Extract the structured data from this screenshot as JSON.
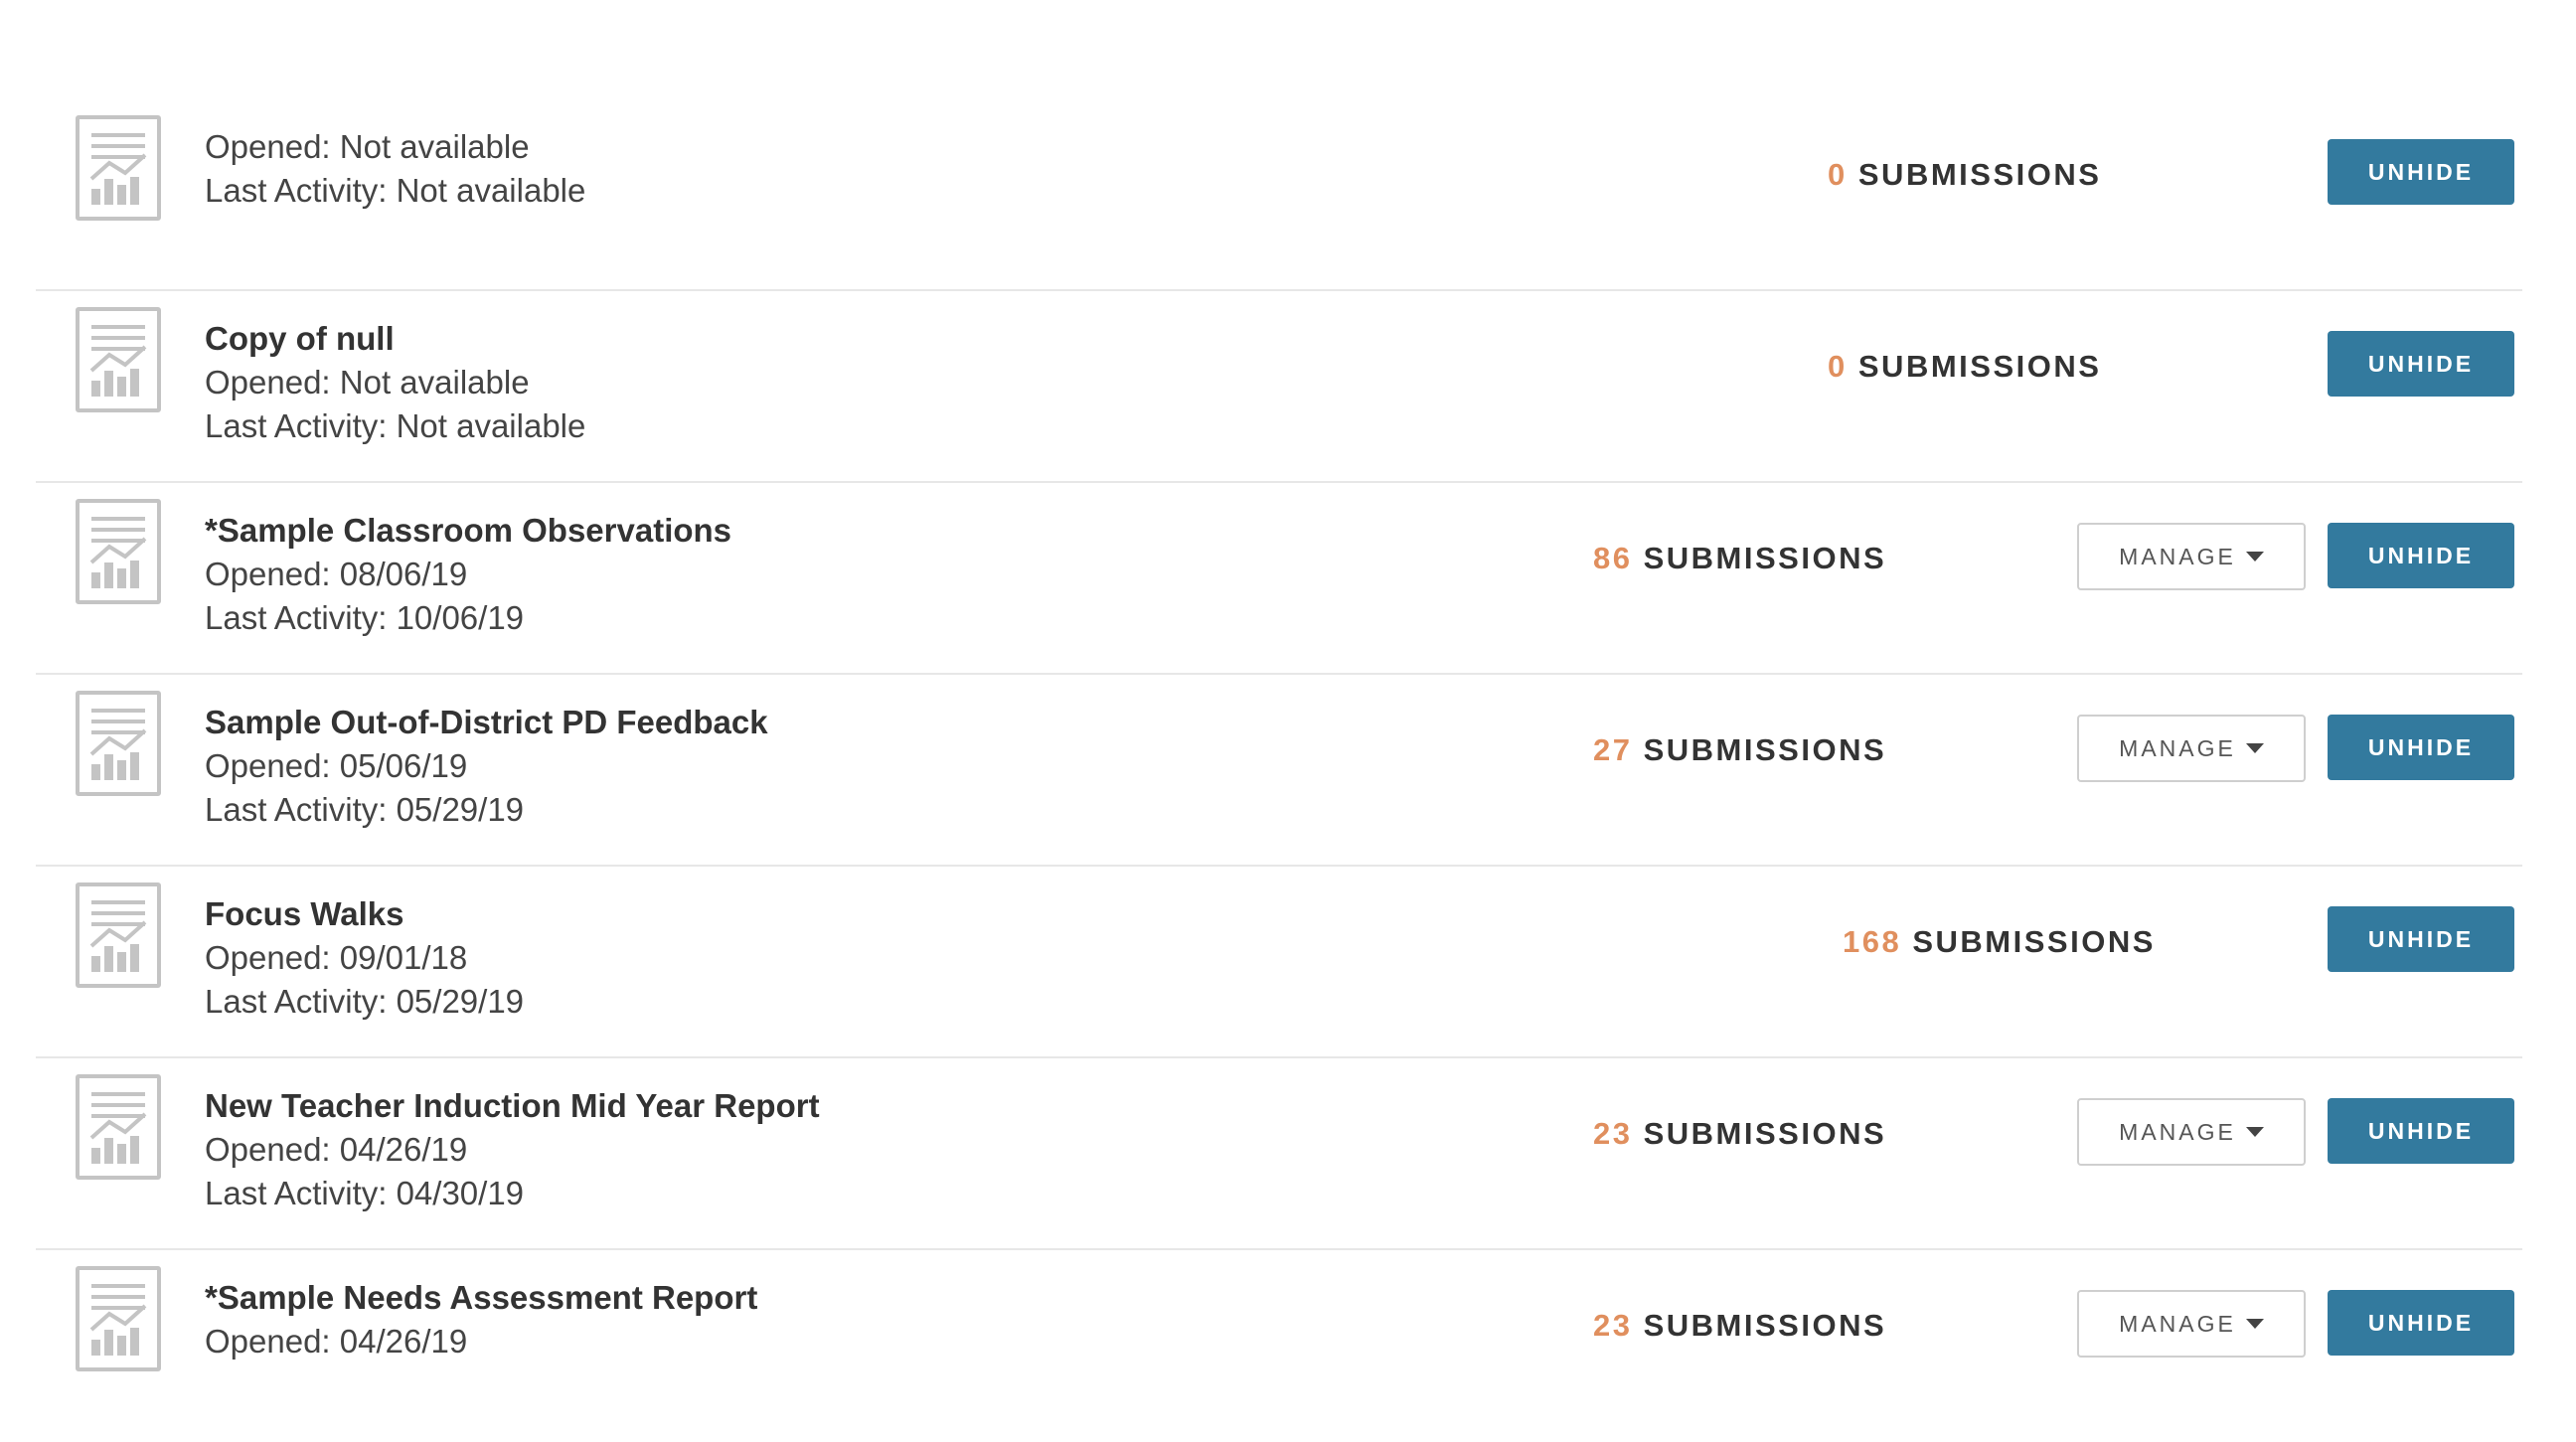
{
  "rows": [
    {
      "title": "",
      "opened": "Opened: Not available",
      "last_activity": "Last Activity: Not available",
      "submission_count": "0",
      "submissions_label": "SUBMISSIONS",
      "unhide_label": "UNHIDE",
      "icon": "report-document-icon"
    },
    {
      "title": "Copy of null",
      "opened": "Opened: Not available",
      "last_activity": "Last Activity: Not available",
      "submission_count": "0",
      "submissions_label": "SUBMISSIONS",
      "unhide_label": "UNHIDE",
      "icon": "report-document-icon"
    },
    {
      "title": "*Sample Classroom Observations",
      "opened": "Opened: 08/06/19",
      "last_activity": "Last Activity: 10/06/19",
      "submission_count": "86",
      "submissions_label": "SUBMISSIONS",
      "manage_label": "MANAGE",
      "unhide_label": "UNHIDE",
      "icon": "report-document-icon"
    },
    {
      "title": "Sample Out-of-District PD Feedback",
      "opened": "Opened: 05/06/19",
      "last_activity": "Last Activity: 05/29/19",
      "submission_count": "27",
      "submissions_label": "SUBMISSIONS",
      "manage_label": "MANAGE",
      "unhide_label": "UNHIDE",
      "icon": "report-document-icon"
    },
    {
      "title": "Focus Walks",
      "opened": "Opened: 09/01/18",
      "last_activity": "Last Activity: 05/29/19",
      "submission_count": "168",
      "submissions_label": "SUBMISSIONS",
      "unhide_label": "UNHIDE",
      "icon": "report-document-icon"
    },
    {
      "title": "New Teacher Induction Mid Year Report",
      "opened": "Opened: 04/26/19",
      "last_activity": "Last Activity: 04/30/19",
      "submission_count": "23",
      "submissions_label": "SUBMISSIONS",
      "manage_label": "MANAGE",
      "unhide_label": "UNHIDE",
      "icon": "report-document-icon"
    },
    {
      "title": "*Sample Needs Assessment Report",
      "opened": "Opened: 04/26/19",
      "last_activity": "",
      "submission_count": "23",
      "submissions_label": "SUBMISSIONS",
      "manage_label": "MANAGE",
      "unhide_label": "UNHIDE",
      "icon": "report-document-icon"
    }
  ],
  "colors": {
    "accent": "#337a9e",
    "count": "#e08f5e",
    "divider": "#e7e7e7",
    "icon": "#c4c4c4"
  }
}
